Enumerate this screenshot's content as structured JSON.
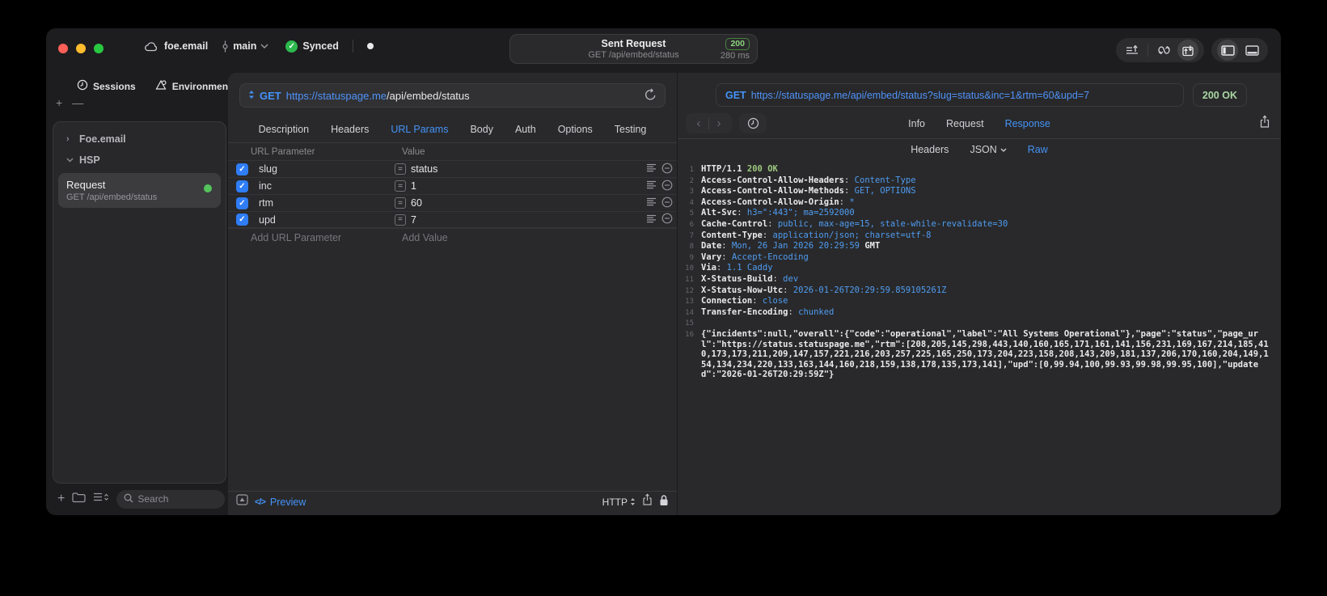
{
  "colors": {
    "accent_blue": "#4493f8",
    "status_green": "#54c35b",
    "badge_green": "#8bd47d",
    "code_value_blue": "#4f9cf0",
    "code_green": "#9dc87e"
  },
  "titlebar": {
    "project": "foe.email",
    "branch": "main",
    "sync_status": "Synced",
    "center": {
      "title": "Sent Request",
      "subtitle": "GET /api/embed/status",
      "status_code": "200",
      "duration": "280 ms"
    }
  },
  "sidebar": {
    "tabs": [
      {
        "label": "Sessions"
      },
      {
        "label": "Environments"
      }
    ],
    "tree": [
      {
        "label": "Foe.email",
        "state": "collapsed"
      },
      {
        "label": "HSP",
        "state": "expanded"
      }
    ],
    "request_item": {
      "title": "Request",
      "subtitle": "GET /api/embed/status"
    },
    "search_placeholder": "Search"
  },
  "request": {
    "method": "GET",
    "url_host": "https://statuspage.me",
    "url_path": "/api/embed/status",
    "tabs": [
      "Description",
      "Headers",
      "URL Params",
      "Body",
      "Auth",
      "Options",
      "Testing"
    ],
    "active_tab": "URL Params",
    "params": {
      "col_name": "URL Parameter",
      "col_value": "Value",
      "rows": [
        {
          "name": "slug",
          "value": "status",
          "checked": true
        },
        {
          "name": "inc",
          "value": "1",
          "checked": true
        },
        {
          "name": "rtm",
          "value": "60",
          "checked": true
        },
        {
          "name": "upd",
          "value": "7",
          "checked": true
        }
      ],
      "add_name_placeholder": "Add URL Parameter",
      "add_value_placeholder": "Add Value"
    },
    "footer": {
      "preview_label": "Preview",
      "protocol": "HTTP"
    }
  },
  "response": {
    "method": "GET",
    "url": "https://statuspage.me/api/embed/status?slug=status&inc=1&rtm=60&upd=7",
    "status": "200 OK",
    "tabs": [
      "Info",
      "Request",
      "Response"
    ],
    "active_tab": "Response",
    "view_tabs": [
      "Headers",
      "JSON",
      "Raw"
    ],
    "active_view": "Raw",
    "code_lines": [
      {
        "n": "1",
        "parts": [
          [
            "HTTP/1.1 ",
            "h"
          ],
          [
            "200 OK",
            "g"
          ]
        ]
      },
      {
        "n": "2",
        "parts": [
          [
            "Access-Control-Allow-Headers",
            "h"
          ],
          [
            ": ",
            "w"
          ],
          [
            "Content-Type",
            "v"
          ]
        ]
      },
      {
        "n": "3",
        "parts": [
          [
            "Access-Control-Allow-Methods",
            "h"
          ],
          [
            ": ",
            "w"
          ],
          [
            "GET, OPTIONS",
            "v"
          ]
        ]
      },
      {
        "n": "4",
        "parts": [
          [
            "Access-Control-Allow-Origin",
            "h"
          ],
          [
            ": ",
            "w"
          ],
          [
            "*",
            "v"
          ]
        ]
      },
      {
        "n": "5",
        "parts": [
          [
            "Alt-Svc",
            "h"
          ],
          [
            ": ",
            "w"
          ],
          [
            "h3=\":443\"; ma=2592000",
            "v"
          ]
        ]
      },
      {
        "n": "6",
        "parts": [
          [
            "Cache-Control",
            "h"
          ],
          [
            ": ",
            "w"
          ],
          [
            "public, max-age=15, stale-while-revalidate=30",
            "v"
          ]
        ]
      },
      {
        "n": "7",
        "parts": [
          [
            "Content-Type",
            "h"
          ],
          [
            ": ",
            "w"
          ],
          [
            "application/json; charset=utf-8",
            "v"
          ]
        ]
      },
      {
        "n": "8",
        "parts": [
          [
            "Date",
            "h"
          ],
          [
            ": ",
            "w"
          ],
          [
            "Mon, 26 Jan 2026 20:29:59 ",
            "v"
          ],
          [
            "GMT",
            "h"
          ]
        ]
      },
      {
        "n": "9",
        "parts": [
          [
            "Vary",
            "h"
          ],
          [
            ": ",
            "w"
          ],
          [
            "Accept-Encoding",
            "v"
          ]
        ]
      },
      {
        "n": "10",
        "parts": [
          [
            "Via",
            "h"
          ],
          [
            ": ",
            "w"
          ],
          [
            "1.1 Caddy",
            "v"
          ]
        ]
      },
      {
        "n": "11",
        "parts": [
          [
            "X-Status-Build",
            "h"
          ],
          [
            ": ",
            "w"
          ],
          [
            "dev",
            "v"
          ]
        ]
      },
      {
        "n": "12",
        "parts": [
          [
            "X-Status-Now-Utc",
            "h"
          ],
          [
            ": ",
            "w"
          ],
          [
            "2026-01-26T20:29:59.859105261Z",
            "v"
          ]
        ]
      },
      {
        "n": "13",
        "parts": [
          [
            "Connection",
            "h"
          ],
          [
            ": ",
            "w"
          ],
          [
            "close",
            "v"
          ]
        ]
      },
      {
        "n": "14",
        "parts": [
          [
            "Transfer-Encoding",
            "h"
          ],
          [
            ": ",
            "w"
          ],
          [
            "chunked",
            "v"
          ]
        ]
      },
      {
        "n": "15",
        "parts": []
      },
      {
        "n": "16",
        "parts": [
          [
            "{\"incidents\":null,\"overall\":{\"code\":\"operational\",\"label\":\"All Systems Operational\"},\"page\":\"status\",\"page_url\":\"https://status.statuspage.me\",\"rtm\":[208,205,145,298,443,140,160,165,171,161,141,156,231,169,167,214,185,410,173,173,211,209,147,157,221,216,203,257,225,165,250,173,204,223,158,208,143,209,181,137,206,170,160,204,149,154,134,234,220,133,163,144,160,218,159,138,178,135,173,141],\"upd\":[0,99.94,100,99.93,99.98,99.95,100],\"updated\":\"2026-01-26T20:29:59Z\"}",
            "h"
          ]
        ]
      }
    ]
  }
}
